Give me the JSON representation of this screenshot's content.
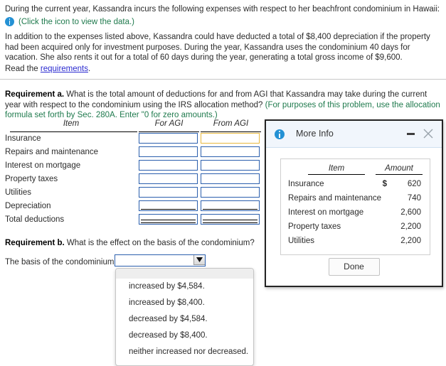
{
  "intro": {
    "line1": "During the current year, Kassandra incurs the following expenses with respect to her beachfront condominium in Hawaii:",
    "icon_hint": "(Click the icon to view the data.)",
    "paragraph": "In addition to the expenses listed above, Kassandra could have deducted a total of $8,400 depreciation if the property had been acquired only for investment purposes. During the year, Kassandra uses the condominium 40 days for vacation. She also rents it out for a total of 60 days during the year, generating a total gross income of $9,600.",
    "read_prefix": "Read the ",
    "read_link": "requirements",
    "read_suffix": "."
  },
  "requirement_a": {
    "label": "Requirement a.",
    "question": " What is the total amount of deductions for and from AGI that Kassandra may take during the current year with respect to the condominium using the IRS allocation method? ",
    "hint": "(For purposes of this problem, use the allocation formula set forth by Sec. 280A. Enter \"0 for zero amounts.)"
  },
  "answer_table": {
    "headers": {
      "item": "Item",
      "for_agi": "For AGI",
      "from_agi": "From AGI"
    },
    "rows": [
      {
        "label": "Insurance",
        "for_agi": "",
        "from_agi": "",
        "rule": "none",
        "focus": "from_agi"
      },
      {
        "label": "Repairs and maintenance",
        "for_agi": "",
        "from_agi": "",
        "rule": "none",
        "focus": ""
      },
      {
        "label": "Interest on mortgage",
        "for_agi": "",
        "from_agi": "",
        "rule": "none",
        "focus": ""
      },
      {
        "label": "Property taxes",
        "for_agi": "",
        "from_agi": "",
        "rule": "none",
        "focus": ""
      },
      {
        "label": "Utilities",
        "for_agi": "",
        "from_agi": "",
        "rule": "none",
        "focus": ""
      },
      {
        "label": "Depreciation",
        "for_agi": "",
        "from_agi": "",
        "rule": "single",
        "focus": ""
      },
      {
        "label": "Total deductions",
        "for_agi": "",
        "from_agi": "",
        "rule": "double",
        "focus": ""
      }
    ]
  },
  "requirement_b": {
    "label": "Requirement b.",
    "question": " What is the effect on the basis of the condominium?",
    "basis_label": "The basis of the condominium is",
    "select_value": "",
    "options": [
      "increased by $4,584.",
      "increased by $8,400.",
      "decreased by $4,584.",
      "decreased by $8,400.",
      "neither increased nor decreased."
    ]
  },
  "more_info": {
    "title": "More Info",
    "icon": "info-icon",
    "minimize_icon": "minimize-icon",
    "close_icon": "close-icon",
    "headers": {
      "item": "Item",
      "amount": "Amount"
    },
    "rows": [
      {
        "label": "Insurance",
        "currency": "$",
        "amount": "620"
      },
      {
        "label": "Repairs and maintenance",
        "currency": "",
        "amount": "740"
      },
      {
        "label": "Interest on mortgage",
        "currency": "",
        "amount": "2,600"
      },
      {
        "label": "Property taxes",
        "currency": "",
        "amount": "2,200"
      },
      {
        "label": "Utilities",
        "currency": "",
        "amount": "2,200"
      }
    ],
    "done_label": "Done"
  },
  "colors": {
    "accent_blue": "#2491d4",
    "input_border": "#2b5fad",
    "focus_border": "#e8b93e",
    "hint_green": "#1f7a4d",
    "link_blue": "#2a2ad0",
    "dialog_header": "#f1f6fc"
  }
}
